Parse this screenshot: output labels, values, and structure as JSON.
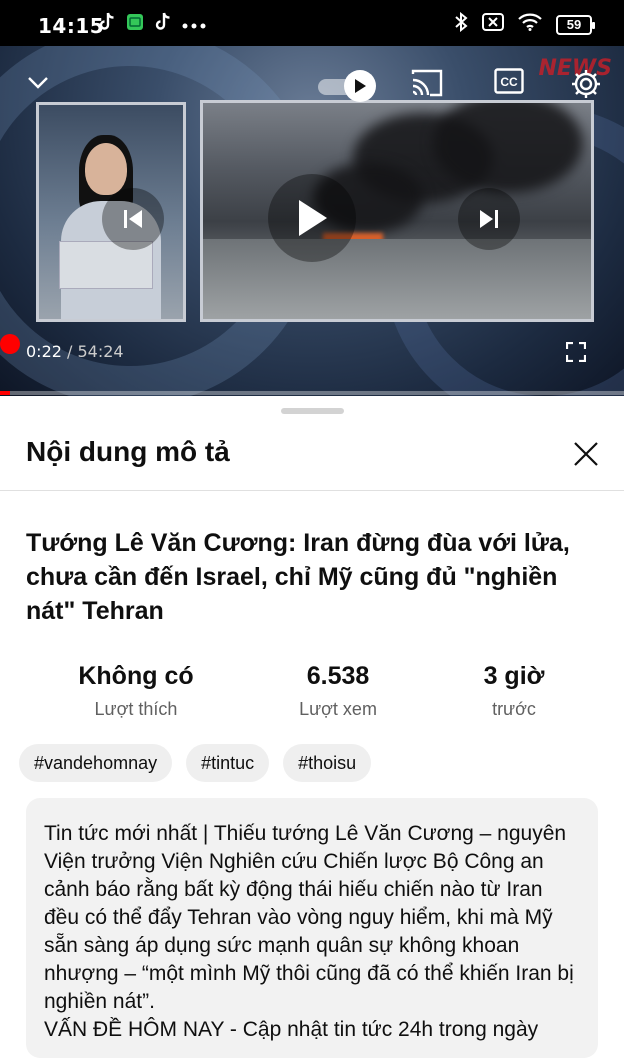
{
  "status_bar": {
    "time": "14:15",
    "battery": "59"
  },
  "player": {
    "current_time": "0:22",
    "separator": " / ",
    "duration": "54:24",
    "progress_fraction": 0.0067,
    "channel_logo_text": "NEWS"
  },
  "sheet": {
    "title": "Nội dung mô tả",
    "video_title": "Tướng Lê Văn Cương: Iran đừng đùa với lửa, chưa cần đến Israel, chỉ Mỹ cũng đủ \"nghiền nát\" Tehran",
    "stats": [
      {
        "value": "Không có",
        "label": "Lượt thích"
      },
      {
        "value": "6.538",
        "label": "Lượt xem"
      },
      {
        "value": "3 giờ",
        "label": "trước"
      }
    ],
    "tags": [
      "#vandehomnay",
      "#tintuc",
      "#thoisu"
    ],
    "description": "Tin tức mới nhất | Thiếu tướng Lê Văn Cương – nguyên Viện trưởng Viện Nghiên cứu Chiến lược Bộ Công an cảnh báo rằng bất kỳ động thái hiếu chiến nào từ Iran đều có thể đẩy Tehran vào vòng nguy hiểm, khi mà Mỹ sẵn sàng áp dụng sức mạnh quân sự không khoan nhượng – “một mình Mỹ thôi cũng đã có thể khiến Iran bị nghiền nát”.\nVẤN ĐỀ HÔM NAY - Cập nhật tin tức 24h trong ngày"
  },
  "colors": {
    "progress": "#ff0000",
    "chip_bg": "#efefef",
    "desc_bg": "#f2f2f2"
  }
}
